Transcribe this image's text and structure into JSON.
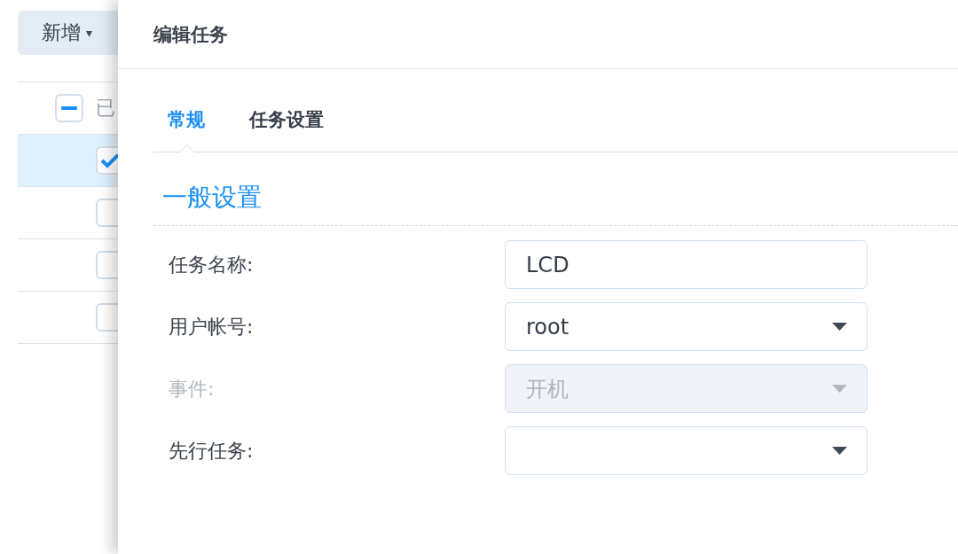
{
  "background": {
    "add_button": {
      "label": "新增",
      "caret": "▾"
    },
    "header_row": {
      "indeterminate": true,
      "text": "已"
    },
    "rows": [
      {
        "selected": true,
        "checked": true
      },
      {
        "selected": false,
        "checked": false
      },
      {
        "selected": false,
        "checked": false
      },
      {
        "selected": false,
        "checked": false
      }
    ]
  },
  "dialog": {
    "title": "编辑任务",
    "tabs": [
      {
        "label": "常规",
        "selected": true
      },
      {
        "label": "任务设置",
        "selected": false
      }
    ],
    "section_title": "一般设置",
    "fields": [
      {
        "kind": "text",
        "label": "任务名称:",
        "value": "LCD",
        "disabled": false
      },
      {
        "kind": "select",
        "label": "用户帐号:",
        "value": "root",
        "disabled": false
      },
      {
        "kind": "select",
        "label": "事件:",
        "value": "开机",
        "disabled": true
      },
      {
        "kind": "select",
        "label": "先行任务:",
        "disabled": false
      }
    ]
  }
}
